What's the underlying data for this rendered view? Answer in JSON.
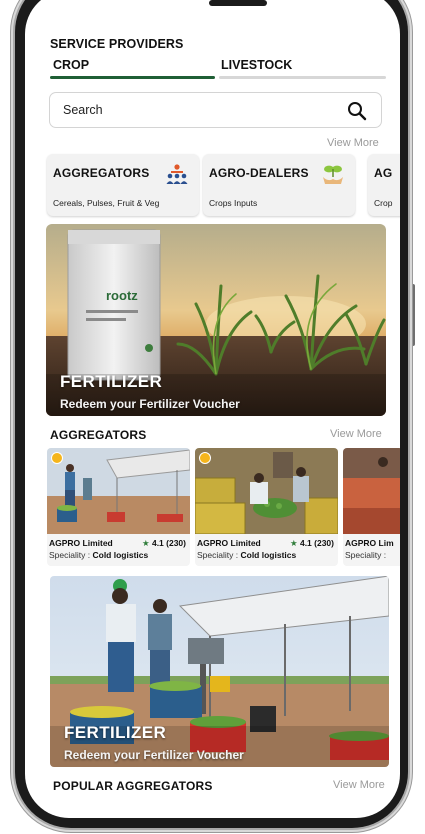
{
  "header": {
    "title": "SERVICE PROVIDERS"
  },
  "tabs": [
    {
      "label": "CROP",
      "active": true
    },
    {
      "label": "LIVESTOCK",
      "active": false
    }
  ],
  "search": {
    "placeholder": "Search",
    "icon": "search-icon"
  },
  "categories": {
    "view_more": "View More",
    "items": [
      {
        "title": "AGGREGATORS",
        "subtitle": "Cereals, Pulses, Fruit & Veg",
        "icon": "people-group-icon"
      },
      {
        "title": "AGRO-DEALERS",
        "subtitle": "Crops Inputs",
        "icon": "seedling-hands-icon"
      },
      {
        "title": "AG",
        "subtitle": "Crop"
      }
    ]
  },
  "banner": {
    "title": "FERTILIZER",
    "subtitle": "Redeem your Fertilizer Voucher",
    "bag_brand": "rootz"
  },
  "aggregators": {
    "section_title": "AGGREGATORS",
    "view_more": "View More",
    "items": [
      {
        "name": "AGPRO Limited",
        "rating": "4.1 (230)",
        "speciality_label": "Speciality :",
        "speciality": "Cold logistics"
      },
      {
        "name": "AGPRO Limited",
        "rating": "4.1 (230)",
        "speciality_label": "Speciality :",
        "speciality": "Cold logistics"
      },
      {
        "name": "AGPRO Lim",
        "speciality_label": "Speciality :"
      }
    ]
  },
  "banner2": {
    "title": "FERTILIZER",
    "subtitle": "Redeem your Fertilizer Voucher"
  },
  "popular": {
    "section_title": "POPULAR AGGREGATORS",
    "view_more": "View More"
  },
  "colors": {
    "accent_green": "#1f5f35",
    "star_green": "#2f7d3b",
    "badge_yellow": "#f5b51c"
  }
}
